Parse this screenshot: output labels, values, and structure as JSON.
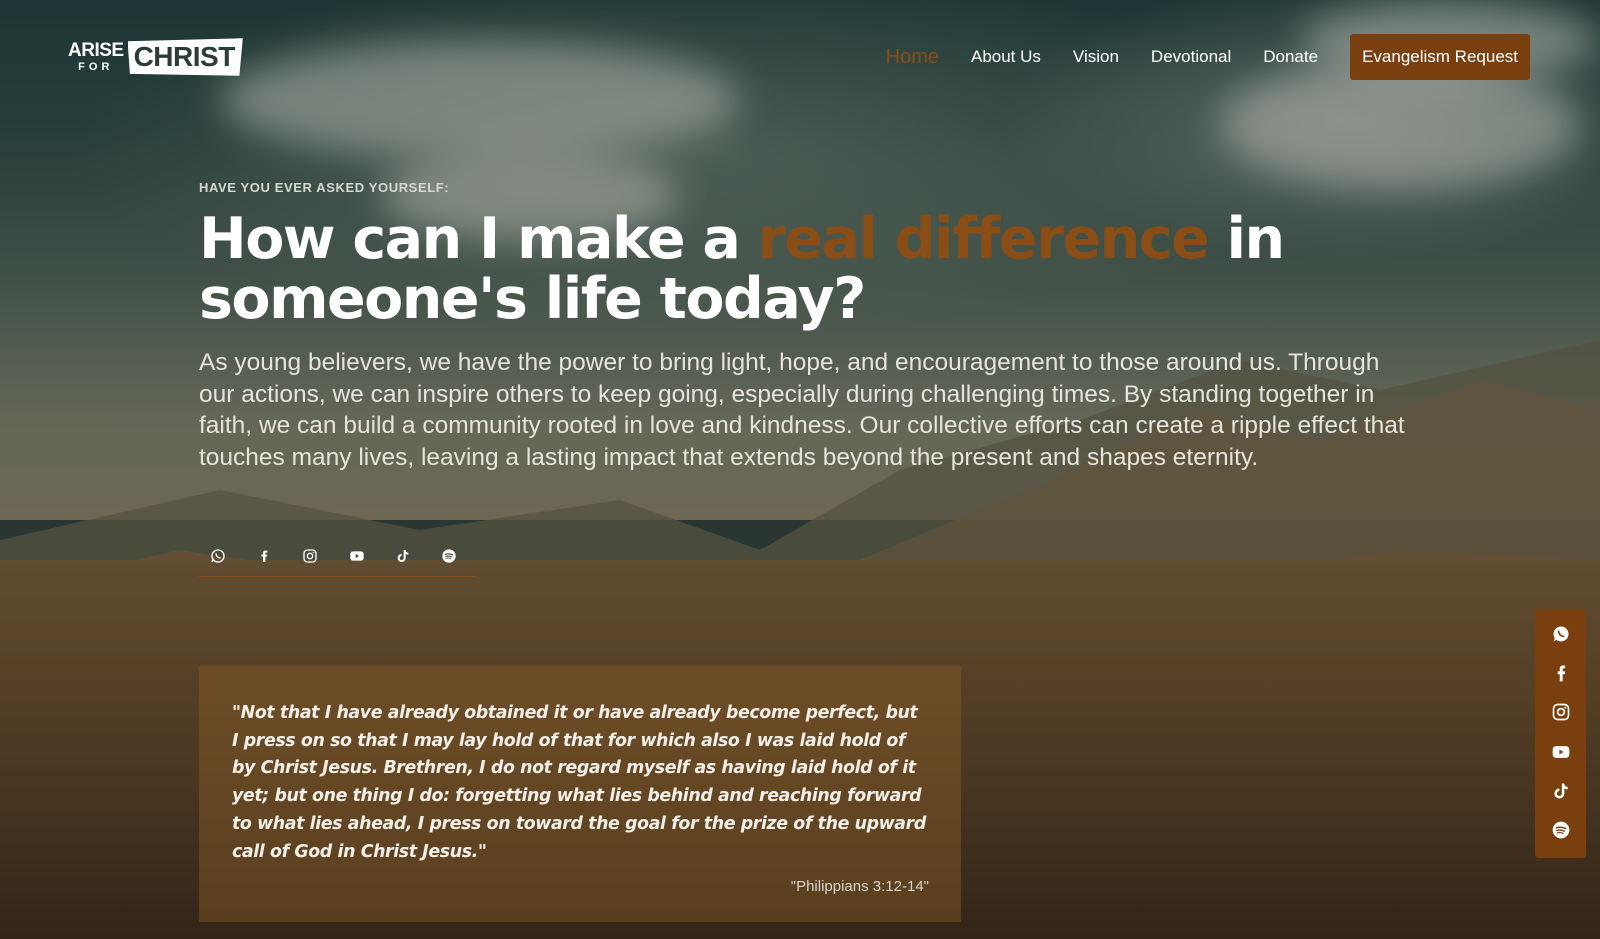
{
  "brand": {
    "logo_top": "ARISE",
    "logo_small": "FOR",
    "logo_word": "CHRIST"
  },
  "nav": {
    "links": [
      "Home",
      "About Us",
      "Vision",
      "Devotional",
      "Donate"
    ],
    "active": "Home",
    "cta": "Evangelism Request"
  },
  "hero": {
    "eyebrow": "HAVE YOU EVER ASKED YOURSELF:",
    "headline_start": "How can I make a ",
    "headline_accent": "real difference",
    "headline_end": " in someone's life today?",
    "lead": "As young believers, we have the power to bring light, hope, and encouragement to those around us. Through our actions, we can inspire others to keep going, especially during challenging times. By standing together in faith, we can build a community rooted in love and kindness. Our collective efforts can create a ripple effect that touches many lives, leaving a lasting impact that extends beyond the present and shapes eternity."
  },
  "social": {
    "icons": [
      "whatsapp-icon",
      "facebook-icon",
      "instagram-icon",
      "youtube-icon",
      "tiktok-icon",
      "spotify-icon"
    ]
  },
  "quote": {
    "text": "\"Not that I have already obtained it or have already become perfect, but I press on so that I may lay hold of that for which also I was laid hold of by Christ Jesus. Brethren, I do not regard myself as having laid hold of it yet; but one thing I do: forgetting what lies behind and reaching forward to what lies ahead, I press on toward the goal for the prize of the upward call of God in Christ Jesus.\"",
    "reference": "\"Philippians 3:12-14\""
  },
  "colors": {
    "accent": "#8a4d16",
    "cta_bg": "#7a3f0f",
    "text": "#ffffff"
  }
}
